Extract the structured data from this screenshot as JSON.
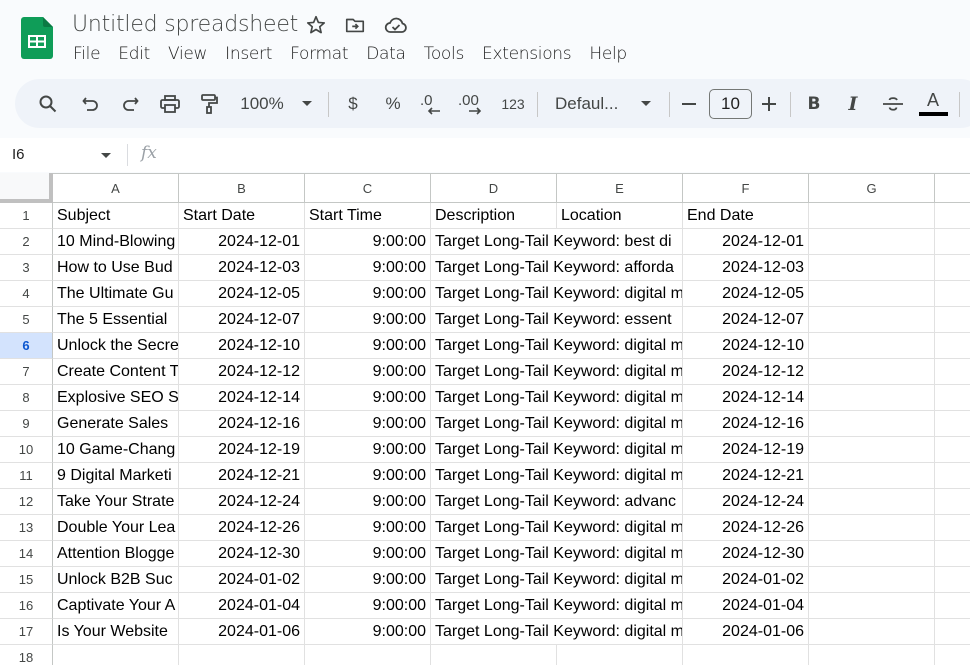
{
  "app": {
    "title": "Untitled spreadsheet",
    "icons": [
      "star-icon",
      "move-to-folder-icon",
      "cloud-saved-icon"
    ]
  },
  "menu": [
    "File",
    "Edit",
    "View",
    "Insert",
    "Format",
    "Data",
    "Tools",
    "Extensions",
    "Help"
  ],
  "toolbar": {
    "zoom": "100%",
    "currency": "$",
    "percent": "%",
    "decrease_decimal": ".0",
    "increase_decimal": ".00",
    "number_format": "123",
    "font": "Defaul...",
    "font_size": "10",
    "bold": "B",
    "italic": "I",
    "text_color_label": "A",
    "text_color": "#000000"
  },
  "formula_bar": {
    "name_box": "I6",
    "fx_label": "fx",
    "value": ""
  },
  "grid": {
    "columns": [
      "A",
      "B",
      "C",
      "D",
      "E",
      "F",
      "G",
      ""
    ],
    "selected_row": 6,
    "row_numbers": [
      "1",
      "2",
      "3",
      "4",
      "5",
      "6",
      "7",
      "8",
      "9",
      "10",
      "11",
      "12",
      "13",
      "14",
      "15",
      "16",
      "17",
      "18"
    ],
    "header_row": [
      "Subject",
      "Start Date",
      "Start Time",
      "Description",
      "Location",
      "End Date"
    ],
    "rows": [
      {
        "subject": "10 Mind-Blowing",
        "start_date": "2024-12-01",
        "start_time": "9:00:00",
        "description": "Target Long-Tail Keyword: best di",
        "location": "",
        "end_date": "2024-12-01"
      },
      {
        "subject": "How to Use Bud",
        "start_date": "2024-12-03",
        "start_time": "9:00:00",
        "description": "Target Long-Tail Keyword: afforda",
        "location": "",
        "end_date": "2024-12-03"
      },
      {
        "subject": "The Ultimate Gu",
        "start_date": "2024-12-05",
        "start_time": "9:00:00",
        "description": "Target Long-Tail Keyword: digital m",
        "location": "",
        "end_date": "2024-12-05"
      },
      {
        "subject": "The 5 Essential",
        "start_date": "2024-12-07",
        "start_time": "9:00:00",
        "description": "Target Long-Tail Keyword: essent",
        "location": "",
        "end_date": "2024-12-07"
      },
      {
        "subject": "Unlock the Secre",
        "start_date": "2024-12-10",
        "start_time": "9:00:00",
        "description": "Target Long-Tail Keyword: digital m",
        "location": "",
        "end_date": "2024-12-10"
      },
      {
        "subject": "Create Content T",
        "start_date": "2024-12-12",
        "start_time": "9:00:00",
        "description": "Target Long-Tail Keyword: digital m",
        "location": "",
        "end_date": "2024-12-12"
      },
      {
        "subject": "Explosive SEO S",
        "start_date": "2024-12-14",
        "start_time": "9:00:00",
        "description": "Target Long-Tail Keyword: digital m",
        "location": "",
        "end_date": "2024-12-14"
      },
      {
        "subject": "Generate Sales",
        "start_date": "2024-12-16",
        "start_time": "9:00:00",
        "description": "Target Long-Tail Keyword: digital m",
        "location": "",
        "end_date": "2024-12-16"
      },
      {
        "subject": "10 Game-Chang",
        "start_date": "2024-12-19",
        "start_time": "9:00:00",
        "description": "Target Long-Tail Keyword: digital m",
        "location": "",
        "end_date": "2024-12-19"
      },
      {
        "subject": "9 Digital Marketi",
        "start_date": "2024-12-21",
        "start_time": "9:00:00",
        "description": "Target Long-Tail Keyword: digital m",
        "location": "",
        "end_date": "2024-12-21"
      },
      {
        "subject": "Take Your Strate",
        "start_date": "2024-12-24",
        "start_time": "9:00:00",
        "description": "Target Long-Tail Keyword: advanc",
        "location": "",
        "end_date": "2024-12-24"
      },
      {
        "subject": "Double Your Lea",
        "start_date": "2024-12-26",
        "start_time": "9:00:00",
        "description": "Target Long-Tail Keyword: digital m",
        "location": "",
        "end_date": "2024-12-26"
      },
      {
        "subject": "Attention Blogge",
        "start_date": "2024-12-30",
        "start_time": "9:00:00",
        "description": "Target Long-Tail Keyword: digital m",
        "location": "",
        "end_date": "2024-12-30"
      },
      {
        "subject": "Unlock B2B Suc",
        "start_date": "2024-01-02",
        "start_time": "9:00:00",
        "description": "Target Long-Tail Keyword: digital m",
        "location": "",
        "end_date": "2024-01-02"
      },
      {
        "subject": "Captivate Your A",
        "start_date": "2024-01-04",
        "start_time": "9:00:00",
        "description": "Target Long-Tail Keyword: digital m",
        "location": "",
        "end_date": "2024-01-04"
      },
      {
        "subject": "Is Your Website",
        "start_date": "2024-01-06",
        "start_time": "9:00:00",
        "description": "Target Long-Tail Keyword: digital m",
        "location": "",
        "end_date": "2024-01-06"
      }
    ]
  }
}
